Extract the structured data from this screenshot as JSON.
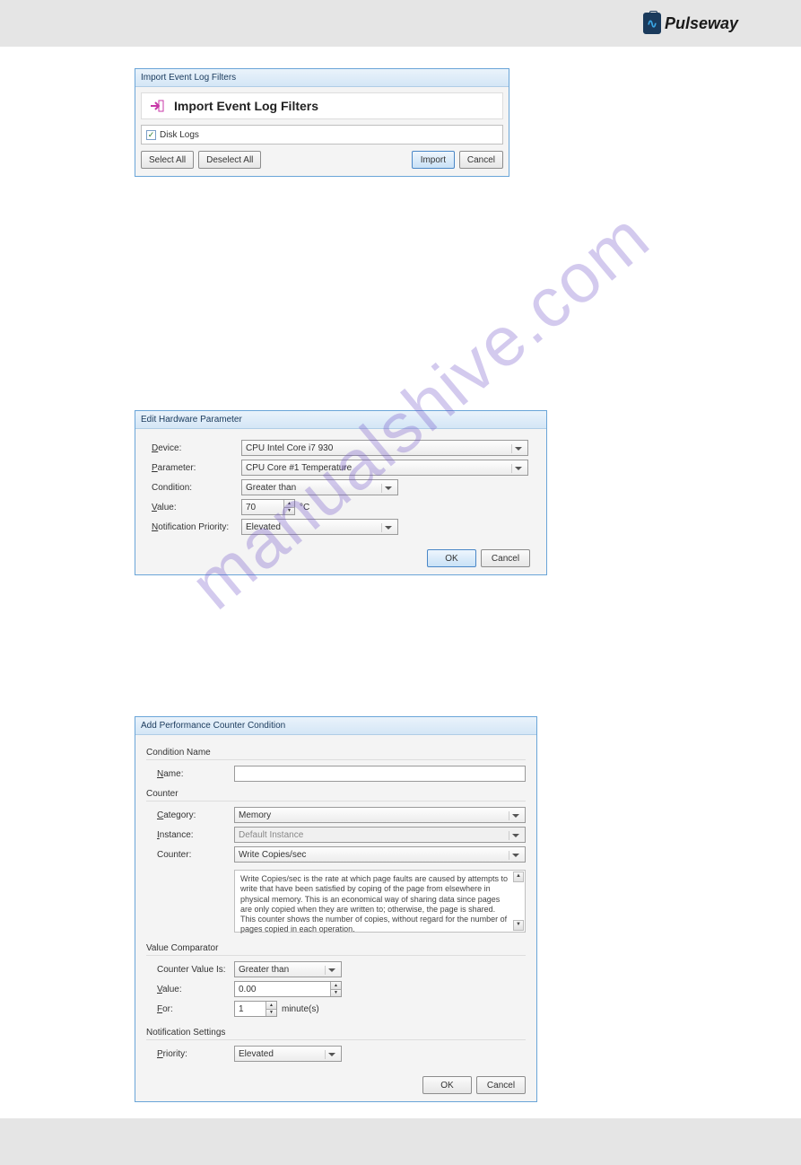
{
  "header": {
    "brand": "Pulseway"
  },
  "watermark": "manualshive.com",
  "dialog1": {
    "title": "Import Event Log Filters",
    "heading": "Import Event Log Filters",
    "item": "Disk Logs",
    "buttons": {
      "select_all": "Select All",
      "deselect_all": "Deselect All",
      "import": "Import",
      "cancel": "Cancel"
    }
  },
  "dialog2": {
    "title": "Edit Hardware Parameter",
    "labels": {
      "device": "Device:",
      "parameter": "Parameter:",
      "condition": "Condition:",
      "value": "Value:",
      "priority": "Notification Priority:"
    },
    "values": {
      "device": "CPU Intel Core i7 930",
      "parameter": "CPU Core #1 Temperature",
      "condition": "Greater than",
      "value": "70",
      "unit": "°C",
      "priority": "Elevated"
    },
    "buttons": {
      "ok": "OK",
      "cancel": "Cancel"
    }
  },
  "dialog3": {
    "title": "Add Performance Counter Condition",
    "sections": {
      "condition_name": "Condition Name",
      "counter": "Counter",
      "value_comparator": "Value Comparator",
      "notification_settings": "Notification Settings"
    },
    "labels": {
      "name": "Name:",
      "category": "Category:",
      "instance": "Instance:",
      "counter": "Counter:",
      "counter_value_is": "Counter Value Is:",
      "value": "Value:",
      "for": "For:",
      "priority": "Priority:"
    },
    "values": {
      "name": "",
      "category": "Memory",
      "instance": "Default Instance",
      "counter": "Write Copies/sec",
      "description": "Write Copies/sec is the rate at which page faults are caused by attempts to write that have been satisfied by coping of the page from elsewhere in physical memory. This is an economical way of sharing data since pages are only copied when they are written to; otherwise, the page is shared. This counter shows the number of copies, without regard for the number of pages copied in each operation.",
      "counter_value_is": "Greater than",
      "value": "0.00",
      "for": "1",
      "for_unit": "minute(s)",
      "priority": "Elevated"
    },
    "buttons": {
      "ok": "OK",
      "cancel": "Cancel"
    }
  }
}
